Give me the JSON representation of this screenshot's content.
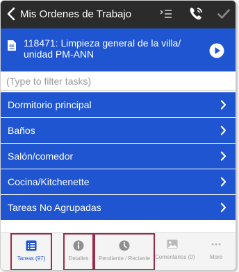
{
  "header": {
    "title": "Mis Ordenes de Trabajo"
  },
  "work_order": {
    "title": "118471: Limpieza general de la villa/ unidad PM-ANN"
  },
  "filter": {
    "placeholder": "(Type to filter tasks)"
  },
  "task_groups": [
    {
      "label": "Dormitorio principal"
    },
    {
      "label": "Baños"
    },
    {
      "label": "Salón/comedor"
    },
    {
      "label": "Cocina/Kitchenette"
    },
    {
      "label": "Tareas No Agrupadas"
    }
  ],
  "tabs": [
    {
      "label": "Tareas (97)",
      "icon": "list-icon",
      "active": true
    },
    {
      "label": "Detalles",
      "icon": "info-icon",
      "active": false
    },
    {
      "label": "Pendiente / Reciente",
      "icon": "clock-icon",
      "active": false
    },
    {
      "label": "Comentarios (0)",
      "icon": "image-icon",
      "active": false
    },
    {
      "label": "More",
      "icon": "more-icon",
      "active": false
    }
  ],
  "colors": {
    "header_bg": "#2b2b2b",
    "accent_blue": "#1f55d1",
    "highlight_outline": "#9c2b49"
  }
}
